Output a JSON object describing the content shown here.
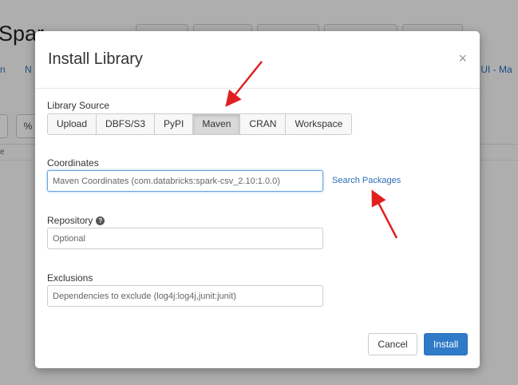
{
  "background": {
    "title": "Spar",
    "link_left_1": "n",
    "link_left_2": "N",
    "link_right": "r UI - Ma",
    "button_glyph": "%",
    "cell_text": "e"
  },
  "modal": {
    "title": "Install Library",
    "close_glyph": "×",
    "library_source_label": "Library Source",
    "sources": [
      {
        "label": "Upload"
      },
      {
        "label": "DBFS/S3"
      },
      {
        "label": "PyPI"
      },
      {
        "label": "Maven",
        "active": true
      },
      {
        "label": "CRAN"
      },
      {
        "label": "Workspace"
      }
    ],
    "coordinates": {
      "label": "Coordinates",
      "placeholder": "Maven Coordinates (com.databricks:spark-csv_2.10:1.0.0)",
      "value": ""
    },
    "search_packages": "Search Packages",
    "repository": {
      "label": "Repository",
      "help_glyph": "?",
      "placeholder": "Optional",
      "value": ""
    },
    "exclusions": {
      "label": "Exclusions",
      "placeholder": "Dependencies to exclude (log4j:log4j,junit:junit)",
      "value": ""
    },
    "cancel_label": "Cancel",
    "install_label": "Install"
  },
  "colors": {
    "accent": "#2f7bc8",
    "annotation_arrow": "#e02020"
  }
}
